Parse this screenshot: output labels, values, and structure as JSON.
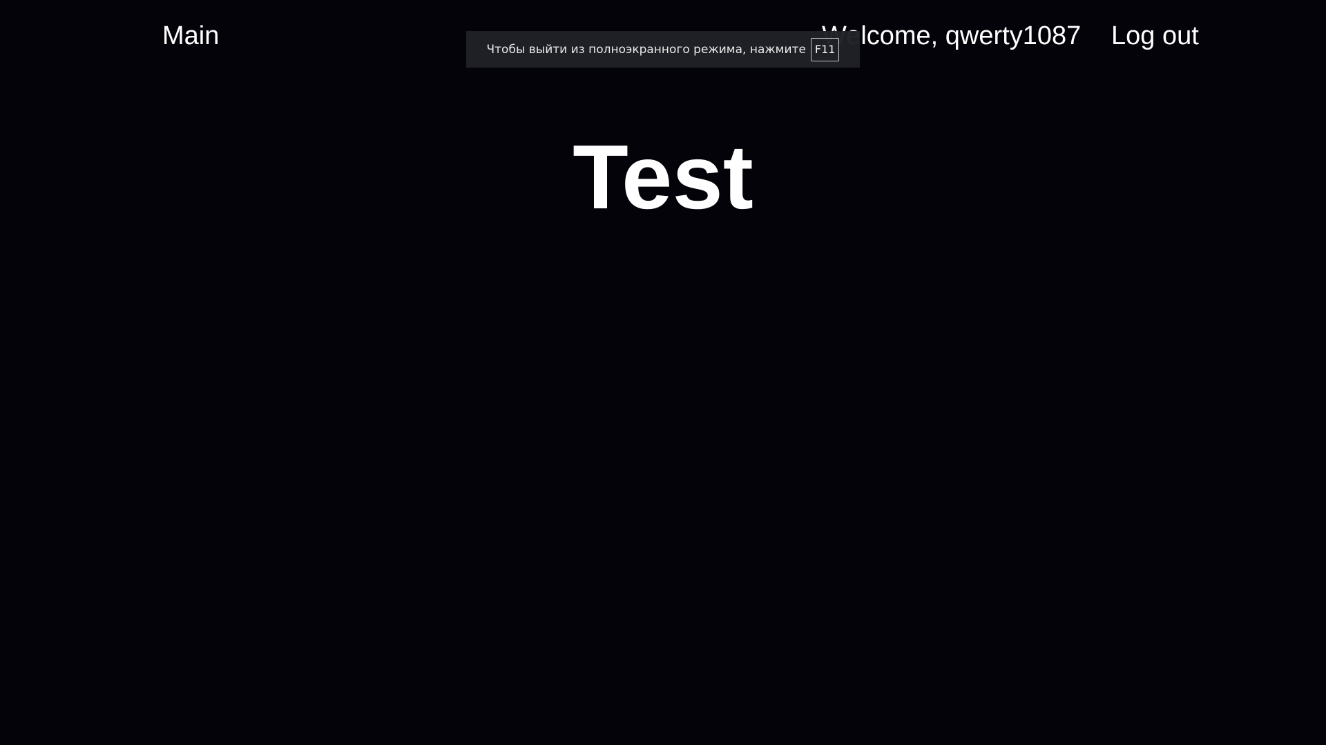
{
  "header": {
    "main_link": "Main",
    "welcome_text": "Welcome, qwerty1087",
    "logout_link": "Log out"
  },
  "fullscreen_notice": {
    "message": "Чтобы выйти из полноэкранного режима, нажмите",
    "key": "F11"
  },
  "main": {
    "title": "Test"
  },
  "colors": {
    "background": "#04030a",
    "text": "#ffffff",
    "toast_background": "#1f2126"
  }
}
